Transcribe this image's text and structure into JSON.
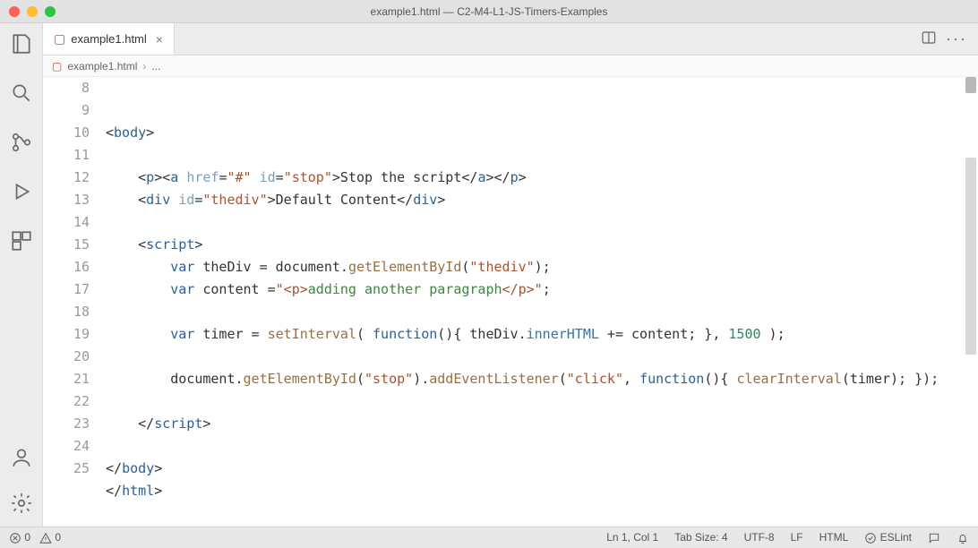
{
  "title": "example1.html — C2-M4-L1-JS-Timers-Examples",
  "tab": {
    "label": "example1.html"
  },
  "breadcrumb": {
    "file": "example1.html",
    "more": "..."
  },
  "status": {
    "errors": "0",
    "warnings": "0",
    "cursor": "Ln 1, Col 1",
    "tab_size": "Tab Size: 4",
    "encoding": "UTF-8",
    "eol": "LF",
    "lang": "HTML",
    "eslint": "ESLint"
  },
  "code": {
    "first_line_number": 8,
    "lines": [
      {
        "n": 8,
        "html": "<span class='tok-punc'>&lt;</span><span class='tok-tag'>body</span><span class='tok-punc'>&gt;</span>"
      },
      {
        "n": 9,
        "html": ""
      },
      {
        "n": 10,
        "html": "    <span class='tok-punc'>&lt;</span><span class='tok-tag'>p</span><span class='tok-punc'>&gt;&lt;</span><span class='tok-tag'>a</span> <span class='tok-attr'>href</span>=<span class='tok-str'>\"#\"</span> <span class='tok-attr'>id</span>=<span class='tok-str'>\"stop\"</span><span class='tok-punc'>&gt;</span>Stop the script<span class='tok-punc'>&lt;/</span><span class='tok-tag'>a</span><span class='tok-punc'>&gt;&lt;/</span><span class='tok-tag'>p</span><span class='tok-punc'>&gt;</span>"
      },
      {
        "n": 11,
        "html": "    <span class='tok-punc'>&lt;</span><span class='tok-tag'>div</span> <span class='tok-attr'>id</span>=<span class='tok-str'>\"thediv\"</span><span class='tok-punc'>&gt;</span>Default Content<span class='tok-punc'>&lt;/</span><span class='tok-tag'>div</span><span class='tok-punc'>&gt;</span>"
      },
      {
        "n": 12,
        "html": ""
      },
      {
        "n": 13,
        "html": "    <span class='tok-punc'>&lt;</span><span class='tok-tag'>script</span><span class='tok-punc'>&gt;</span>"
      },
      {
        "n": 14,
        "html": "        <span class='tok-kw'>var</span> theDiv = document.<span class='tok-fn'>getElementById</span>(<span class='tok-str'>\"thediv\"</span>);"
      },
      {
        "n": 15,
        "html": "        <span class='tok-kw'>var</span> content =<span class='tok-str'>\"&lt;p&gt;</span><span class='tok-strg'>adding another paragraph</span><span class='tok-str'>&lt;/p&gt;\"</span>;"
      },
      {
        "n": 16,
        "html": ""
      },
      {
        "n": 17,
        "html": "        <span class='tok-kw'>var</span> timer = <span class='tok-fn'>setInterval</span>( <span class='tok-kw'>function</span>(){ theDiv.<span class='tok-prop'>innerHTML</span> += content; }, <span class='tok-num'>1500</span> );"
      },
      {
        "n": 18,
        "html": ""
      },
      {
        "n": 19,
        "html": "        document.<span class='tok-fn'>getElementById</span>(<span class='tok-str'>\"stop\"</span>).<span class='tok-fn'>addEventListener</span>(<span class='tok-str'>\"click\"</span>, <span class='tok-kw'>function</span>(){ <span class='tok-fn'>clearInterval</span>(timer); });"
      },
      {
        "n": 20,
        "html": ""
      },
      {
        "n": 21,
        "html": "    <span class='tok-punc'>&lt;/</span><span class='tok-tag'>script</span><span class='tok-punc'>&gt;</span>"
      },
      {
        "n": 22,
        "html": ""
      },
      {
        "n": 23,
        "html": "<span class='tok-punc'>&lt;/</span><span class='tok-tag'>body</span><span class='tok-punc'>&gt;</span>"
      },
      {
        "n": 24,
        "html": "<span class='tok-punc'>&lt;/</span><span class='tok-tag'>html</span><span class='tok-punc'>&gt;</span>"
      },
      {
        "n": 25,
        "html": ""
      }
    ]
  }
}
